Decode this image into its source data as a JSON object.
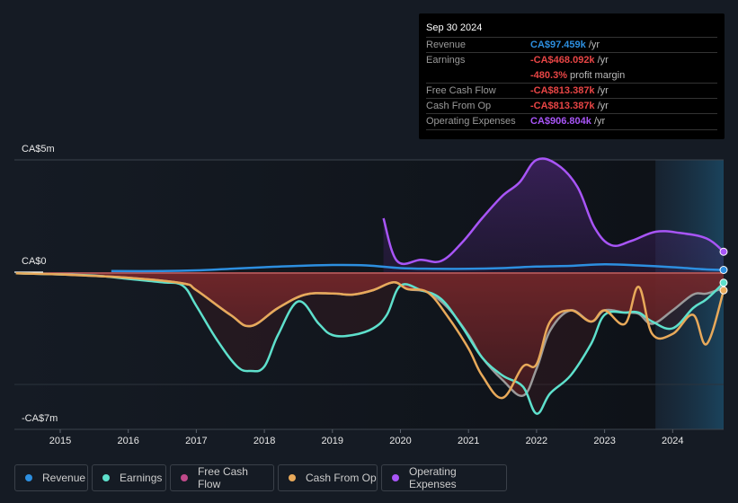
{
  "tooltip": {
    "date": "Sep 30 2024",
    "rows": [
      {
        "label": "Revenue",
        "value": "CA$97.459k",
        "unit": "/yr",
        "color": "#2d8fe0"
      },
      {
        "label": "Earnings",
        "value": "-CA$468.092k",
        "unit": "/yr",
        "color": "#e84545"
      },
      {
        "label": "",
        "value": "-480.3%",
        "unit": "profit margin",
        "color": "#e84545"
      },
      {
        "label": "Free Cash Flow",
        "value": "-CA$813.387k",
        "unit": "/yr",
        "color": "#e84545"
      },
      {
        "label": "Cash From Op",
        "value": "-CA$813.387k",
        "unit": "/yr",
        "color": "#e84545"
      },
      {
        "label": "Operating Expenses",
        "value": "CA$906.804k",
        "unit": "/yr",
        "color": "#a855f7"
      }
    ]
  },
  "legend": [
    {
      "label": "Revenue",
      "color": "#2d8fe0"
    },
    {
      "label": "Earnings",
      "color": "#5ee0cc"
    },
    {
      "label": "Free Cash Flow",
      "color": "#c04a8a"
    },
    {
      "label": "Cash From Op",
      "color": "#e8a95a"
    },
    {
      "label": "Operating Expenses",
      "color": "#a855f7"
    }
  ],
  "chart_data": {
    "type": "area",
    "title": "",
    "xlabel": "",
    "ylabel": "",
    "y_tick_labels": [
      "CA$5m",
      "CA$0",
      "-CA$7m"
    ],
    "x_tick_labels": [
      "2015",
      "2016",
      "2017",
      "2018",
      "2019",
      "2020",
      "2021",
      "2022",
      "2023",
      "2024"
    ],
    "ylim": [
      -7,
      5
    ],
    "units": "CA$ millions",
    "xlim": [
      2014.35,
      2024.75
    ],
    "forecast_start": 2023.75,
    "grid": true,
    "legend_position": "bottom",
    "series": [
      {
        "name": "Revenue",
        "color": "#2d8fe0",
        "x": [
          2015.75,
          2016.5,
          2017.0,
          2017.5,
          2018.0,
          2018.5,
          2019.0,
          2019.5,
          2020.0,
          2020.5,
          2021.0,
          2021.5,
          2022.0,
          2022.5,
          2023.0,
          2023.5,
          2024.0,
          2024.5,
          2024.75
        ],
        "values": [
          0.05,
          0.05,
          0.08,
          0.15,
          0.22,
          0.28,
          0.32,
          0.3,
          0.18,
          0.15,
          0.15,
          0.18,
          0.25,
          0.28,
          0.35,
          0.3,
          0.22,
          0.12,
          0.1
        ]
      },
      {
        "name": "Earnings",
        "color": "#5ee0cc",
        "x": [
          2014.35,
          2015.0,
          2015.5,
          2016.0,
          2016.5,
          2016.8,
          2017.0,
          2017.3,
          2017.6,
          2017.8,
          2018.0,
          2018.2,
          2018.5,
          2018.8,
          2019.0,
          2019.3,
          2019.6,
          2019.8,
          2020.0,
          2020.3,
          2020.6,
          2020.9,
          2021.2,
          2021.5,
          2021.8,
          2022.0,
          2022.2,
          2022.5,
          2022.8,
          2023.0,
          2023.3,
          2023.5,
          2023.7,
          2024.0,
          2024.3,
          2024.5,
          2024.75
        ],
        "values": [
          -0.05,
          -0.1,
          -0.15,
          -0.3,
          -0.45,
          -0.6,
          -1.5,
          -3.0,
          -4.2,
          -4.4,
          -4.2,
          -2.8,
          -1.3,
          -2.3,
          -2.8,
          -2.8,
          -2.5,
          -1.9,
          -0.6,
          -0.8,
          -1.2,
          -2.4,
          -3.8,
          -4.6,
          -5.1,
          -6.3,
          -5.4,
          -4.6,
          -3.2,
          -1.9,
          -1.8,
          -1.8,
          -2.2,
          -2.5,
          -1.6,
          -1.2,
          -0.47
        ]
      },
      {
        "name": "Free Cash Flow",
        "color": "#c04a8a",
        "x": [
          2014.35,
          2015.0,
          2016.0,
          2016.8,
          2017.0,
          2017.5,
          2017.8,
          2018.2,
          2018.6,
          2019.0,
          2019.3,
          2019.6,
          2019.9,
          2020.1,
          2020.4,
          2020.7,
          2021.0,
          2021.2,
          2021.5,
          2021.8,
          2022.0,
          2022.2,
          2022.5,
          2022.8,
          2023.0,
          2023.3,
          2023.5,
          2023.7,
          2024.0,
          2024.3,
          2024.5,
          2024.75
        ],
        "values": [
          -0.05,
          -0.1,
          -0.25,
          -0.5,
          -0.8,
          -1.9,
          -2.4,
          -1.6,
          -1.0,
          -0.95,
          -1.0,
          -0.8,
          -0.45,
          -0.75,
          -0.9,
          -1.6,
          -2.8,
          -3.8,
          -4.8,
          -5.5,
          -4.3,
          -2.6,
          -1.7,
          -2.2,
          -1.7,
          -1.8,
          -1.85,
          -2.3,
          -1.7,
          -1.0,
          -0.95,
          -0.7
        ]
      },
      {
        "name": "Cash From Op",
        "color": "#e8a95a",
        "x": [
          2014.35,
          2015.0,
          2016.0,
          2016.8,
          2017.0,
          2017.5,
          2017.8,
          2018.2,
          2018.6,
          2019.0,
          2019.3,
          2019.6,
          2019.9,
          2020.1,
          2020.4,
          2020.7,
          2021.0,
          2021.2,
          2021.5,
          2021.8,
          2022.0,
          2022.2,
          2022.5,
          2022.8,
          2023.0,
          2023.3,
          2023.5,
          2023.7,
          2024.0,
          2024.3,
          2024.5,
          2024.75
        ],
        "values": [
          -0.05,
          -0.1,
          -0.25,
          -0.5,
          -0.8,
          -1.9,
          -2.4,
          -1.6,
          -1.0,
          -0.95,
          -1.0,
          -0.8,
          -0.45,
          -0.75,
          -0.9,
          -2.0,
          -3.4,
          -4.6,
          -5.6,
          -4.2,
          -4.1,
          -2.2,
          -1.7,
          -2.2,
          -1.7,
          -2.3,
          -0.65,
          -2.75,
          -2.75,
          -1.9,
          -3.2,
          -0.81
        ]
      },
      {
        "name": "Operating Expenses",
        "color": "#a855f7",
        "x": [
          2019.75,
          2019.95,
          2020.3,
          2020.6,
          2020.9,
          2021.2,
          2021.5,
          2021.75,
          2022.0,
          2022.3,
          2022.6,
          2022.85,
          2023.1,
          2023.4,
          2023.75,
          2024.1,
          2024.5,
          2024.75
        ],
        "values": [
          2.4,
          0.5,
          0.55,
          0.5,
          1.3,
          2.4,
          3.4,
          4.0,
          5.0,
          4.8,
          3.8,
          2.0,
          1.2,
          1.4,
          1.8,
          1.75,
          1.5,
          0.91
        ]
      }
    ]
  }
}
